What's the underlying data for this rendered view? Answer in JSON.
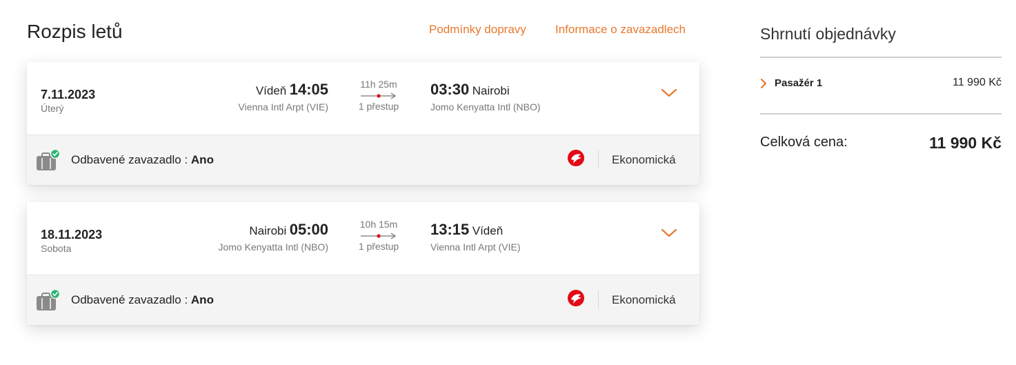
{
  "header": {
    "title": "Rozpis letů",
    "links": [
      "Podmínky dopravy",
      "Informace o zavazadlech"
    ]
  },
  "flights": [
    {
      "date": "7.11.2023",
      "weekday": "Úterý",
      "departure": {
        "city": "Vídeň",
        "time": "14:05",
        "airport": "Vienna Intl Arpt (VIE)"
      },
      "duration": "11h 25m",
      "stops": "1 přestup",
      "arrival": {
        "city": "Nairobi",
        "time": "03:30",
        "airport": "Jomo Kenyatta Intl (NBO)"
      },
      "baggage_label": "Odbavené zavazadlo :",
      "baggage_value": "Ano",
      "cabin": "Ekonomická"
    },
    {
      "date": "18.11.2023",
      "weekday": "Sobota",
      "departure": {
        "city": "Nairobi",
        "time": "05:00",
        "airport": "Jomo Kenyatta Intl (NBO)"
      },
      "duration": "10h 15m",
      "stops": "1 přestup",
      "arrival": {
        "city": "Vídeň",
        "time": "13:15",
        "airport": "Vienna Intl Arpt (VIE)"
      },
      "baggage_label": "Odbavené zavazadlo :",
      "baggage_value": "Ano",
      "cabin": "Ekonomická"
    }
  ],
  "summary": {
    "title": "Shrnutí objednávky",
    "passenger_label": "Pasažér 1",
    "passenger_price": "11 990 Kč",
    "total_label": "Celková cena:",
    "total_value": "11 990 Kč"
  },
  "colors": {
    "accent": "#e8782d",
    "airline_red": "#e30a17",
    "check_green": "#2bb673"
  },
  "icons": [
    "chevron-down-icon",
    "chevron-right-icon",
    "luggage-icon",
    "check-icon",
    "airline-logo-icon",
    "route-arrow-icon"
  ]
}
